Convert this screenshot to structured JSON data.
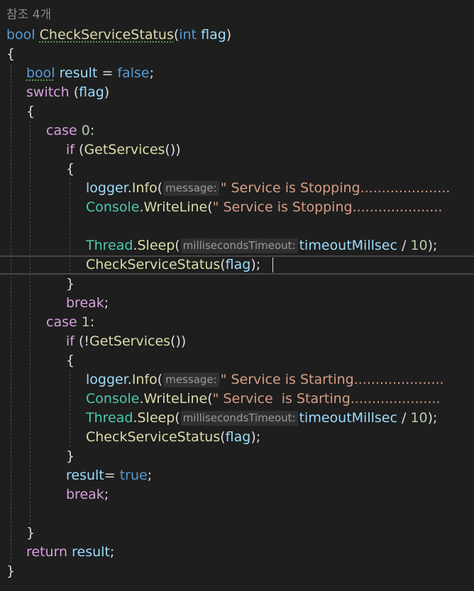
{
  "codelens": {
    "references": "참조 4개"
  },
  "colors": {
    "background": "#1e1e1e",
    "keyword": "#569cd6",
    "control": "#d8a0df",
    "type": "#4ec9b0",
    "method": "#dcdcaa",
    "variable": "#9cdcfe",
    "string": "#d69d85",
    "number": "#b5cea8"
  },
  "tokens": {
    "bool": "bool",
    "int": "int",
    "method_name": "CheckServiceStatus",
    "flag": "flag",
    "result": "result",
    "false_kw": "false",
    "true_kw": "true",
    "switch_kw": "switch",
    "case_kw": "case",
    "zero": "0",
    "one": "1",
    "if_kw": "if",
    "get_services": "GetServices",
    "logger": "logger",
    "info": "Info",
    "console": "Console",
    "writeline": "WriteLine",
    "thread": "Thread",
    "sleep": "Sleep",
    "timeout_var": "timeoutMillsec",
    "ten": "10",
    "break_kw": "break",
    "return_kw": "return"
  },
  "hints": {
    "message": "message:",
    "milliseconds_timeout": "millisecondsTimeout:"
  },
  "strings": {
    "stopping_logger": "\" Service is Stopping.....................",
    "stopping_console": "\" Service is Stopping.....................",
    "starting_logger": "\" Service is Starting.....................",
    "starting_console": "\" Service  is Starting....................."
  }
}
